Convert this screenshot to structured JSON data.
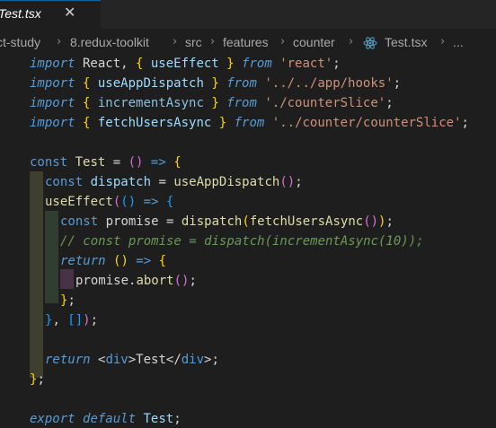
{
  "tab": {
    "title": "Test.tsx",
    "close_icon": "close-icon"
  },
  "breadcrumb": {
    "items": [
      "ct-study",
      "8.redux-toolkit",
      "src",
      "features",
      "counter",
      "Test.tsx",
      "..."
    ],
    "file_icon": "react-icon"
  },
  "code": {
    "line1": {
      "a": "import",
      "b": " React, ",
      "c": "{",
      "d": " useEffect ",
      "e": "}",
      "f": " ",
      "g": "from",
      "h": " ",
      "i": "'react'",
      "j": ";"
    },
    "line2": {
      "a": "import",
      "b": " ",
      "c": "{",
      "d": " useAppDispatch ",
      "e": "}",
      "f": " ",
      "g": "from",
      "h": " ",
      "i": "'../../app/hooks'",
      "j": ";"
    },
    "line3": {
      "a": "import",
      "b": " ",
      "c": "{",
      "d": " incrementAsync ",
      "e": "}",
      "f": " ",
      "g": "from",
      "h": " ",
      "i": "'./counterSlice'",
      "j": ";"
    },
    "line4": {
      "a": "import",
      "b": " ",
      "c": "{",
      "d": " fetchUsersAsync ",
      "e": "}",
      "f": " ",
      "g": "from",
      "h": " ",
      "i": "'../counter/counterSlice'",
      "j": ";"
    },
    "line6": {
      "a": "const",
      "b": " ",
      "c": "Test",
      "d": " = ",
      "e": "()",
      "f": " => ",
      "g": "{"
    },
    "line7": {
      "a": "const",
      "b": " ",
      "c": "dispatch",
      "d": " = ",
      "e": "useAppDispatch",
      "f": "()",
      "g": ";"
    },
    "line8": {
      "a": "useEffect",
      "b": "(",
      "c": "()",
      "d": " => ",
      "e": "{"
    },
    "line9": {
      "a": "const",
      "b": " promise = ",
      "c": "dispatch",
      "d": "(",
      "e": "fetchUsersAsync",
      "f": "()",
      "g": ")",
      "h": ";"
    },
    "line10": {
      "a": "// const promise = dispatch(incrementAsync(10));"
    },
    "line11": {
      "a": "return",
      "b": " ",
      "c": "()",
      "d": " => ",
      "e": "{"
    },
    "line12": {
      "a": "promise",
      "b": ".",
      "c": "abort",
      "d": "()",
      "e": ";"
    },
    "line13": {
      "a": "}",
      "b": ";"
    },
    "line14": {
      "a": "}",
      "b": ", ",
      "c": "[]",
      "d": ")",
      "e": ";"
    },
    "line16": {
      "a": "return",
      "b": " <",
      "c": "div",
      "d": ">",
      "e": "Test",
      "f": "</",
      "g": "div",
      "h": ">",
      "i": ";"
    },
    "line17": {
      "a": "}",
      "b": ";"
    },
    "line19": {
      "a": "export",
      "b": " ",
      "c": "default",
      "d": " Test",
      "e": ";"
    }
  }
}
